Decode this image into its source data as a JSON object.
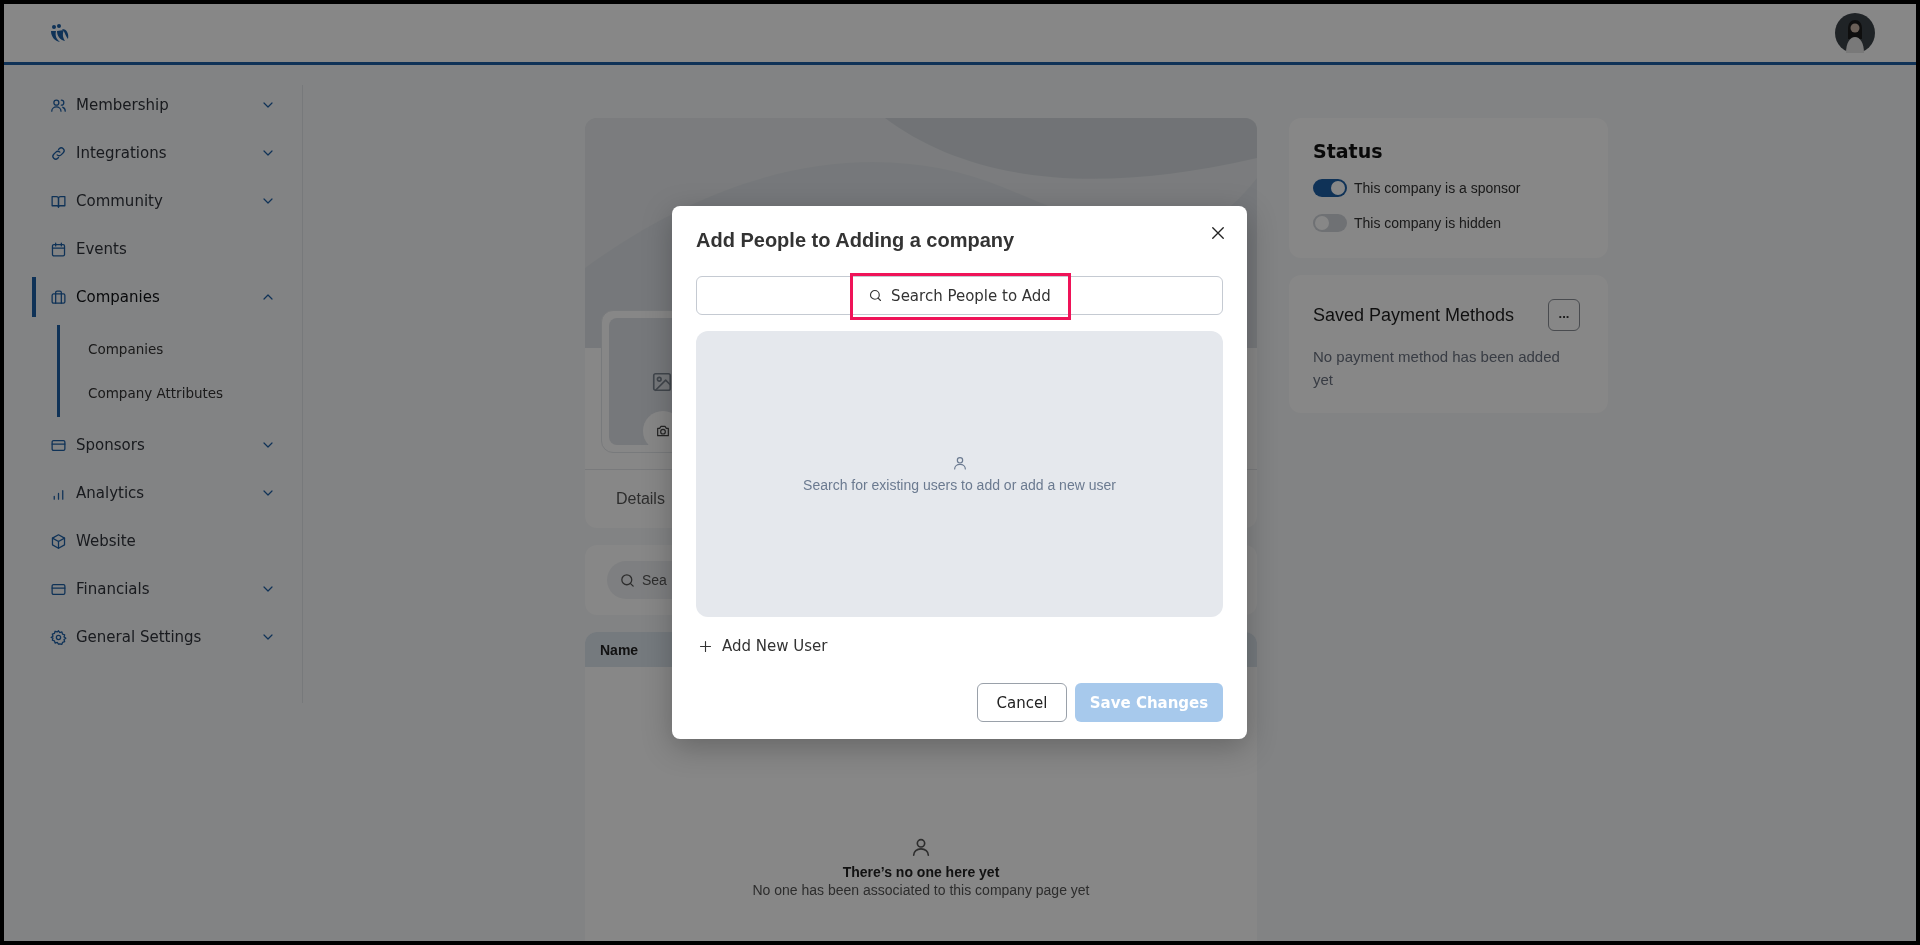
{
  "sidebar": {
    "items": [
      {
        "label": "Membership",
        "kind": "group",
        "expanded": false,
        "selected": false
      },
      {
        "label": "Integrations",
        "kind": "group",
        "expanded": false,
        "selected": false
      },
      {
        "label": "Community",
        "kind": "group",
        "expanded": false,
        "selected": false
      },
      {
        "label": "Events",
        "kind": "link",
        "selected": false
      },
      {
        "label": "Companies",
        "kind": "group",
        "expanded": true,
        "selected": true,
        "children": [
          {
            "label": "Companies"
          },
          {
            "label": "Company Attributes"
          }
        ]
      },
      {
        "label": "Sponsors",
        "kind": "group",
        "expanded": false,
        "selected": false
      },
      {
        "label": "Analytics",
        "kind": "group",
        "expanded": false,
        "selected": false
      },
      {
        "label": "Website",
        "kind": "link",
        "selected": false
      },
      {
        "label": "Financials",
        "kind": "group",
        "expanded": false,
        "selected": false
      },
      {
        "label": "General Settings",
        "kind": "group",
        "expanded": false,
        "selected": false
      }
    ]
  },
  "company_card": {
    "tabs": [
      {
        "label": "Details"
      }
    ],
    "search": {
      "placeholder": "Sea"
    },
    "table": {
      "columns": [
        "Name"
      ]
    },
    "empty_state": {
      "title": "There’s no one here yet",
      "message": "No one has been associated to this company page yet"
    }
  },
  "status_card": {
    "title": "Status",
    "toggles": [
      {
        "label": "This company is a sponsor",
        "on": true
      },
      {
        "label": "This company is hidden",
        "on": false
      }
    ]
  },
  "payment_card": {
    "title": "Saved Payment Methods",
    "menu_button": "...",
    "message": "No payment method has been added yet"
  },
  "dialog": {
    "title": "Add People to Adding a company",
    "search": {
      "placeholder": "Search People to Add",
      "highlighted": true
    },
    "empty_message": "Search for existing users to add or add a new user",
    "add_link": "Add New User",
    "buttons": [
      {
        "label": "Cancel",
        "kind": "secondary",
        "disabled": false
      },
      {
        "label": "Save Changes",
        "kind": "primary",
        "disabled": true
      }
    ]
  }
}
